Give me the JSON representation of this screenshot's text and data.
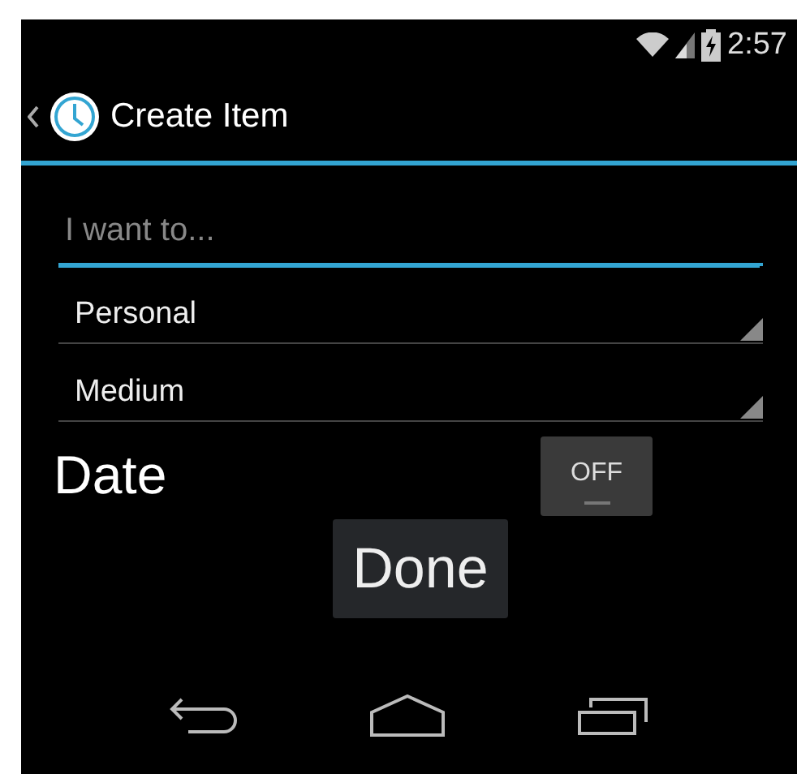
{
  "status_bar": {
    "time": "2:57"
  },
  "action_bar": {
    "title": "Create Item"
  },
  "task_field": {
    "placeholder": "I want to..."
  },
  "spinners": [
    {
      "value": "Personal"
    },
    {
      "value": "Medium"
    }
  ],
  "date": {
    "label": "Date",
    "toggle": {
      "text": "OFF",
      "on": false
    }
  },
  "done_button": "Done"
}
